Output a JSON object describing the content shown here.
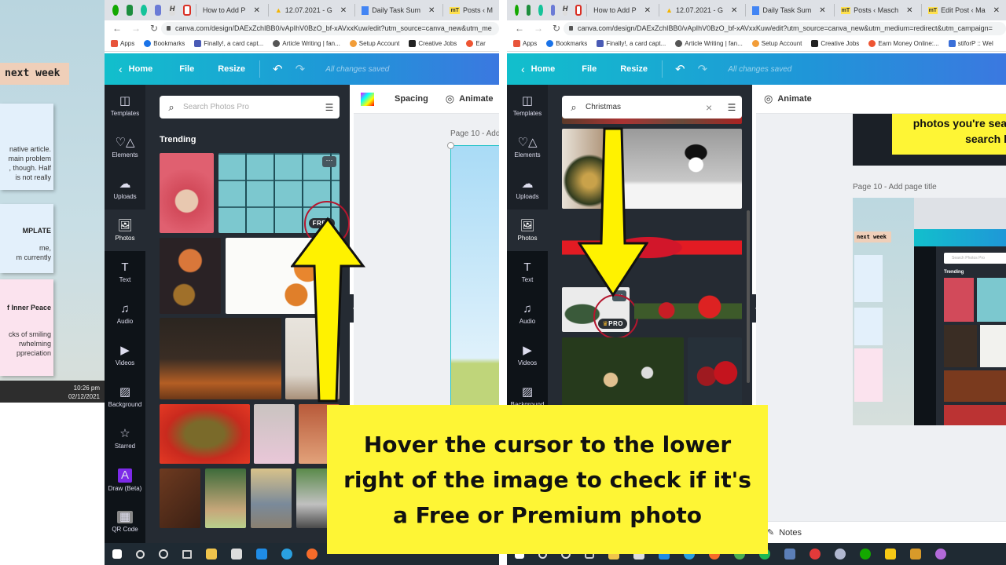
{
  "desktop": {
    "sticky_tape": "next week",
    "notes": [
      {
        "title": "",
        "lines": [
          "native article.",
          "main problem",
          ", though. Half",
          "is not really"
        ]
      },
      {
        "title": "MPLATE",
        "lines": [
          "me,",
          "m currently"
        ]
      },
      {
        "title": "f Inner Peace",
        "lines": [
          "cks of smiling",
          "rwhelming",
          "ppreciation"
        ]
      }
    ],
    "clock_time": "10:26 pm",
    "clock_date": "02/12/2021"
  },
  "left_window": {
    "tabs": [
      {
        "label": "How to Add P"
      },
      {
        "label": "12.07.2021 - G"
      },
      {
        "label": "Daily Task Sum"
      },
      {
        "label": "Posts ‹ M"
      }
    ],
    "url": "canva.com/design/DAExZchIBB0/vApIhV0BzO_bf-xAVxxKuw/edit?utm_source=canva_new&utm_me",
    "bookmarks": [
      "Apps",
      "Bookmarks",
      "Finally!, a card capt...",
      "Article Writing | fan...",
      "Setup Account",
      "Creative Jobs",
      "Ear"
    ],
    "canva_menu": {
      "home": "Home",
      "file": "File",
      "resize": "Resize",
      "status": "All changes saved"
    },
    "rail": [
      "Templates",
      "Elements",
      "Uploads",
      "Photos",
      "Text",
      "Audio",
      "Videos",
      "Background",
      "Starred",
      "Draw (Beta)",
      "QR Code"
    ],
    "search_placeholder": "Search Photos Pro",
    "section_title": "Trending",
    "free_badge": "FREE",
    "more_label": "···",
    "toolbar": {
      "spacing": "Spacing",
      "animate": "Animate"
    },
    "page_label": "Page 10 - Add"
  },
  "right_window": {
    "tabs": [
      {
        "label": "How to Add P"
      },
      {
        "label": "12.07.2021 - G"
      },
      {
        "label": "Daily Task Sum"
      },
      {
        "label": "Posts ‹ Masch"
      },
      {
        "label": "Edit Post ‹ Ma"
      }
    ],
    "url": "canva.com/design/DAExZchIBB0/vApIhV0BzO_bf-xAVxxKuw/edit?utm_source=canva_new&utm_medium=redirect&utm_campaign=",
    "bookmarks": [
      "Apps",
      "Bookmarks",
      "Finally!, a card capt...",
      "Article Writing | fan...",
      "Setup Account",
      "Creative Jobs",
      "Earn Money Online:...",
      "stiforP :: Wel"
    ],
    "canva_menu": {
      "home": "Home",
      "file": "File",
      "resize": "Resize",
      "status": "All changes saved"
    },
    "rail": [
      "Templates",
      "Elements",
      "Uploads",
      "Photos",
      "Text",
      "Audio",
      "Videos",
      "Background"
    ],
    "search_value": "Christmas",
    "pro_badge": "PRO",
    "more_label": "···",
    "toolbar": {
      "animate": "Animate"
    },
    "preview_text": [
      "photos you're sea",
      "search l"
    ],
    "page_label": "Page 10 - Add page title",
    "notes_label": "Notes",
    "mini_preview": {
      "tape": "next week",
      "section": "Trending",
      "placeholder": "Search Photos Pro"
    }
  },
  "callout": "Hover the cursor to the lower right of the image to check if it's a Free or Premium photo",
  "colors": {
    "canva_gradient_start": "#12bfcc",
    "canva_gradient_end": "#3b78e0",
    "panel": "#252b33",
    "rail": "#0e1318",
    "callout": "#fef535",
    "circle": "#b5162e",
    "arrow": "#fff200"
  }
}
